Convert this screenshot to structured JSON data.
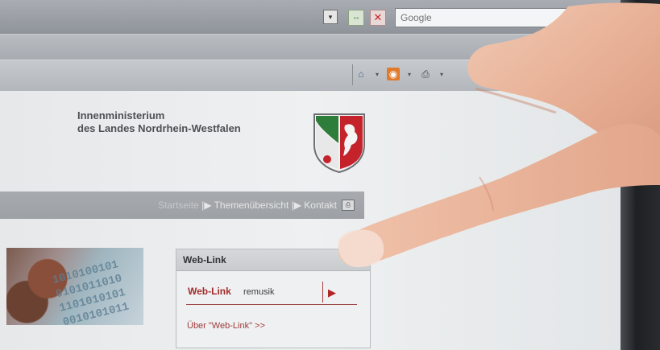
{
  "browser": {
    "search_placeholder": "Google",
    "dropdown_glyph": "▾",
    "go_glyph": "↔",
    "stop_glyph": "✕",
    "toolbar_icons": [
      "home-icon",
      "feed-icon",
      "print-icon"
    ]
  },
  "header": {
    "ministry_line1": "Innenministerium",
    "ministry_line2": "des Landes Nordrhein-Westfalen"
  },
  "nav": {
    "startseite": "Startseite",
    "sep1": " |▶ ",
    "themen": "Themenübersicht",
    "sep2": " |▶ ",
    "kontakt": "Kontakt"
  },
  "weblink": {
    "title": "Web-Link",
    "label": "Web-Link",
    "input_value": "remusik",
    "go_glyph": "▶",
    "about": "Über \"Web-Link\" >>"
  },
  "colors": {
    "accent_red": "#a32b2b",
    "nav_bg": "#a2a6aa"
  }
}
